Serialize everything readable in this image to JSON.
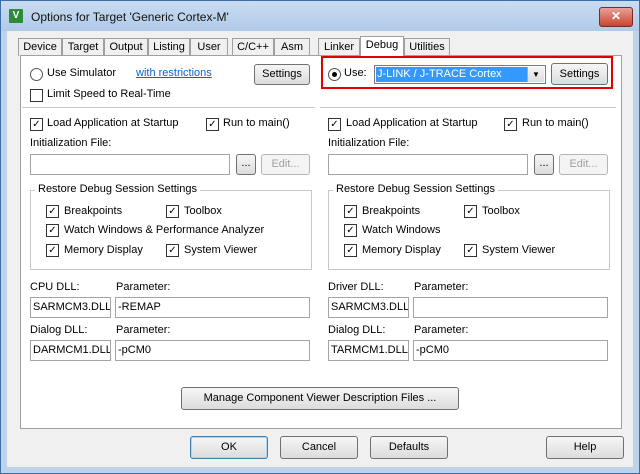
{
  "window": {
    "title": "Options for Target 'Generic Cortex-M'",
    "app_icon_letter": "V",
    "close_glyph": "✕"
  },
  "tabs": [
    {
      "label": "Device"
    },
    {
      "label": "Target"
    },
    {
      "label": "Output"
    },
    {
      "label": "Listing"
    },
    {
      "label": "User"
    },
    {
      "label": "C/C++"
    },
    {
      "label": "Asm"
    },
    {
      "label": "Linker"
    },
    {
      "label": "Debug",
      "selected": true
    },
    {
      "label": "Utilities"
    }
  ],
  "left": {
    "use_simulator_label": "Use Simulator",
    "use_simulator_selected": false,
    "restrictions_link": "with restrictions",
    "settings_button": "Settings",
    "limit_speed_label": "Limit Speed to Real-Time",
    "limit_speed_checked": false,
    "load_app_label": "Load Application at Startup",
    "load_app_checked": true,
    "run_to_main_label": "Run to main()",
    "run_to_main_checked": true,
    "init_file_label": "Initialization File:",
    "init_file_value": "",
    "browse_button": "...",
    "edit_button": "Edit...",
    "restore_group_title": "Restore Debug Session Settings",
    "breakpoints_label": "Breakpoints",
    "toolbox_label": "Toolbox",
    "watch_label": "Watch Windows & Performance Analyzer",
    "memory_label": "Memory Display",
    "sysviewer_label": "System Viewer",
    "cpu_dll_label": "CPU DLL:",
    "cpu_param_label": "Parameter:",
    "cpu_dll_value": "SARMCM3.DLL",
    "cpu_param_value": "-REMAP",
    "dialog_dll_label": "Dialog DLL:",
    "dialog_param_label": "Parameter:",
    "dialog_dll_value": "DARMCM1.DLL",
    "dialog_param_value": "-pCM0"
  },
  "right": {
    "use_label": "Use:",
    "use_selected": true,
    "debugger_value": "J-LINK / J-TRACE Cortex",
    "settings_button": "Settings",
    "highlight_color": "#e00000",
    "load_app_label": "Load Application at Startup",
    "load_app_checked": true,
    "run_to_main_label": "Run to main()",
    "run_to_main_checked": true,
    "init_file_label": "Initialization File:",
    "init_file_value": "",
    "browse_button": "...",
    "edit_button": "Edit...",
    "restore_group_title": "Restore Debug Session Settings",
    "breakpoints_label": "Breakpoints",
    "toolbox_label": "Toolbox",
    "watch_label": "Watch Windows",
    "memory_label": "Memory Display",
    "sysviewer_label": "System Viewer",
    "driver_dll_label": "Driver DLL:",
    "driver_param_label": "Parameter:",
    "driver_dll_value": "SARMCM3.DLL",
    "driver_param_value": "",
    "dialog_dll_label": "Dialog DLL:",
    "dialog_param_label": "Parameter:",
    "dialog_dll_value": "TARMCM1.DLL",
    "dialog_param_value": "-pCM0"
  },
  "manage_button": "Manage Component Viewer Description Files ...",
  "footer": {
    "ok": "OK",
    "cancel": "Cancel",
    "defaults": "Defaults",
    "help": "Help"
  },
  "check_glyph": "✓",
  "dropdown_glyph": "▼"
}
